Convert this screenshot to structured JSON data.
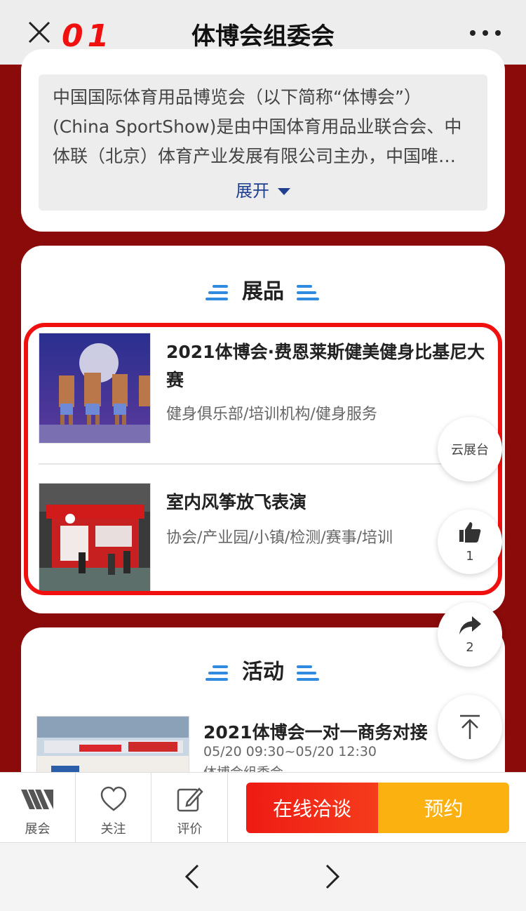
{
  "topbar": {
    "title": "体博会组委会",
    "annotation": "01"
  },
  "intro": {
    "text": "中国国际体育用品博览会（以下简称“体博会”）(China SportShow)是由中国体育用品业联合会、中体联（北京）体育产业发展有限公司主办，中国唯…",
    "expand_label": "展开"
  },
  "products": {
    "section_title": "展品",
    "items": [
      {
        "title": "2021体博会·费恩莱斯健美健身比基尼大赛",
        "subtitle": "健身俱乐部/培训机构/健身服务"
      },
      {
        "title": "室内风筝放飞表演",
        "subtitle": "协会/产业园/小镇/检测/赛事/培训"
      }
    ]
  },
  "activity": {
    "section_title": "活动",
    "item": {
      "title": "2021体博会一对一商务对接",
      "time": "05/20 09:30~05/20 12:30",
      "organizer": "体博会组委会"
    }
  },
  "floating": {
    "cloud_label": "云展台",
    "like_count": "1",
    "share_count": "2"
  },
  "actionbar": {
    "expo_label": "展会",
    "follow_label": "关注",
    "review_label": "评价",
    "chat_label": "在线洽谈",
    "book_label": "预约"
  },
  "colors": {
    "page_bg": "#8b0a0a",
    "accent_red": "#ee1b14",
    "accent_orange": "#fbb110",
    "link_blue": "#1f3f8f",
    "title_line_blue": "#2f8ae0"
  }
}
